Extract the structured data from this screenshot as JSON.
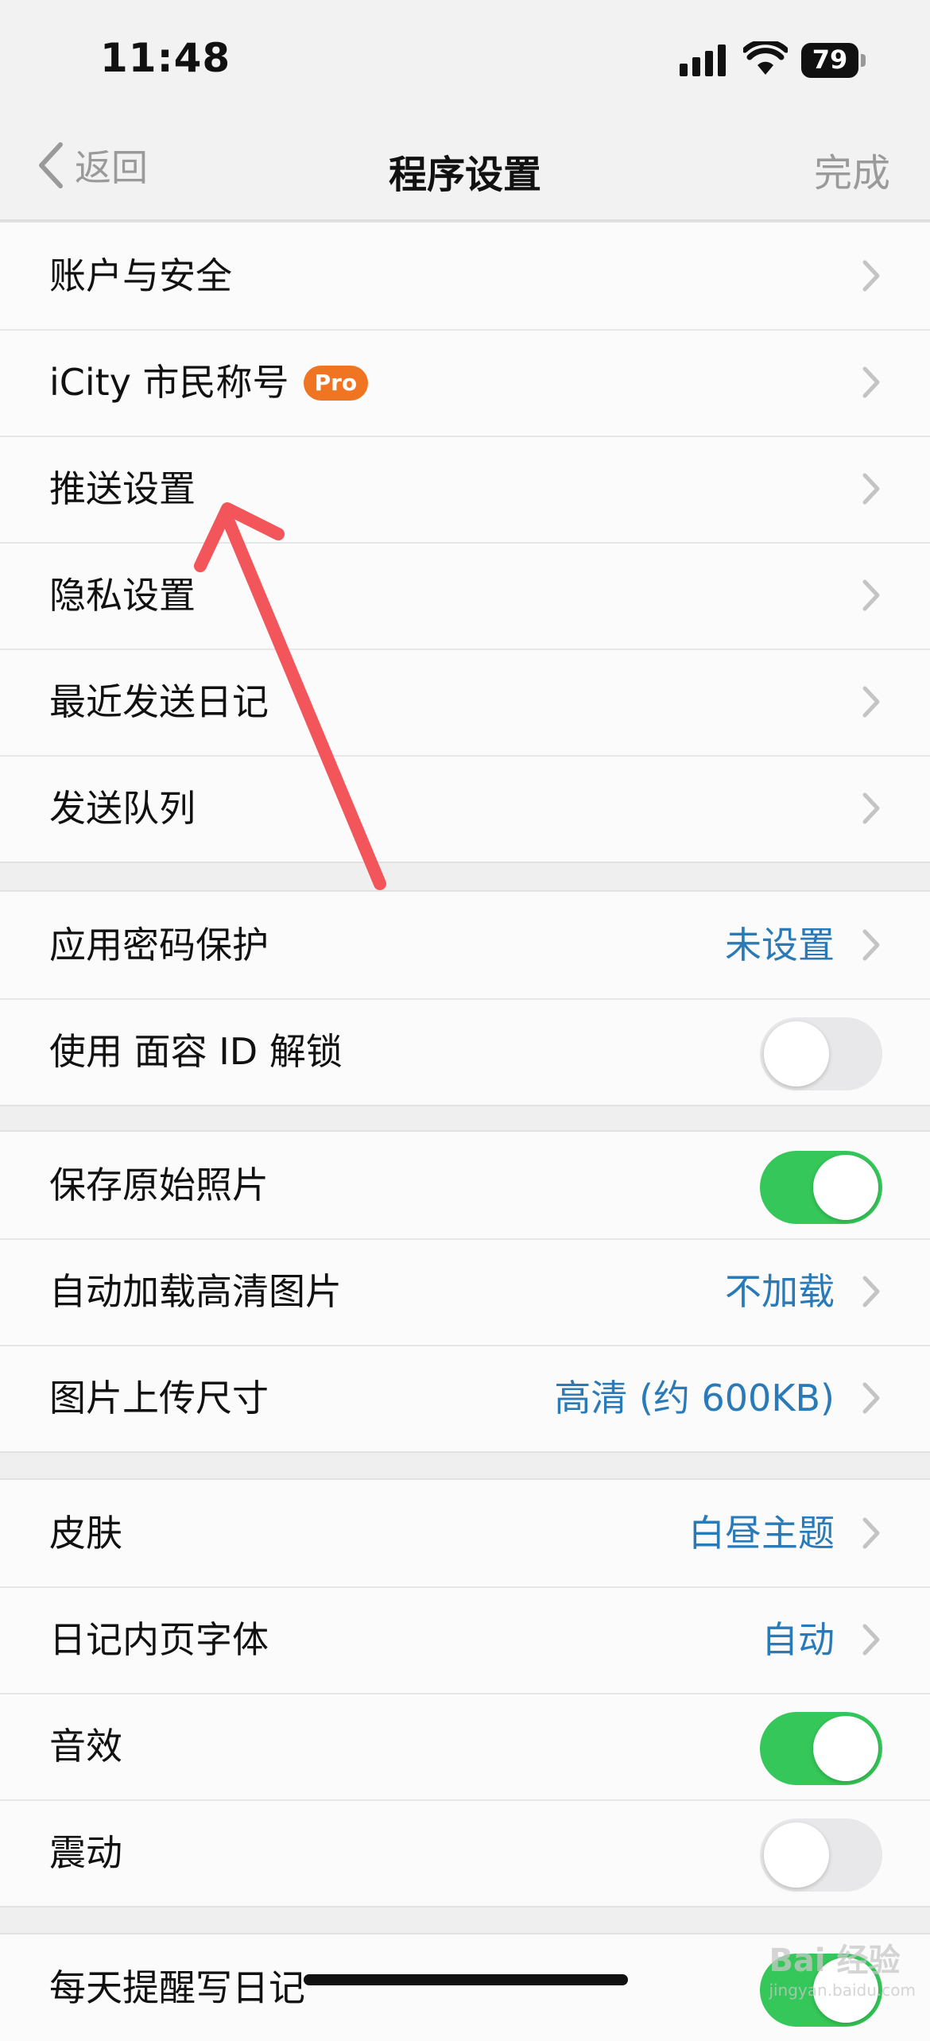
{
  "status_bar": {
    "time": "11:48",
    "battery": "79"
  },
  "nav": {
    "back_label": "返回",
    "title": "程序设置",
    "done_label": "完成"
  },
  "groups": [
    {
      "rows": [
        {
          "label": "账户与安全"
        },
        {
          "label": "iCity 市民称号",
          "badge": "Pro"
        },
        {
          "label": "推送设置"
        },
        {
          "label": "隐私设置"
        },
        {
          "label": "最近发送日记"
        },
        {
          "label": "发送队列"
        }
      ]
    },
    {
      "rows": [
        {
          "label": "应用密码保护",
          "value": "未设置"
        },
        {
          "label": "使用 面容 ID 解锁",
          "toggle": false
        }
      ]
    },
    {
      "rows": [
        {
          "label": "保存原始照片",
          "toggle": true
        },
        {
          "label": "自动加载高清图片",
          "value": "不加载"
        },
        {
          "label": "图片上传尺寸",
          "value": "高清 (约 600KB)"
        }
      ]
    },
    {
      "rows": [
        {
          "label": "皮肤",
          "value": "白昼主题"
        },
        {
          "label": "日记内页字体",
          "value": "自动"
        },
        {
          "label": "音效",
          "toggle": true
        },
        {
          "label": "震动",
          "toggle": false
        }
      ]
    },
    {
      "rows": [
        {
          "label": "每天提醒写日记",
          "toggle": true
        }
      ]
    }
  ],
  "watermark": {
    "text": "Bai 经验",
    "sub": "jingyan.baidu.com"
  },
  "colors": {
    "accent": "#2a7ab8",
    "toggle_on": "#35c759",
    "badge": "#f07522",
    "arrow": "#f2555a"
  }
}
